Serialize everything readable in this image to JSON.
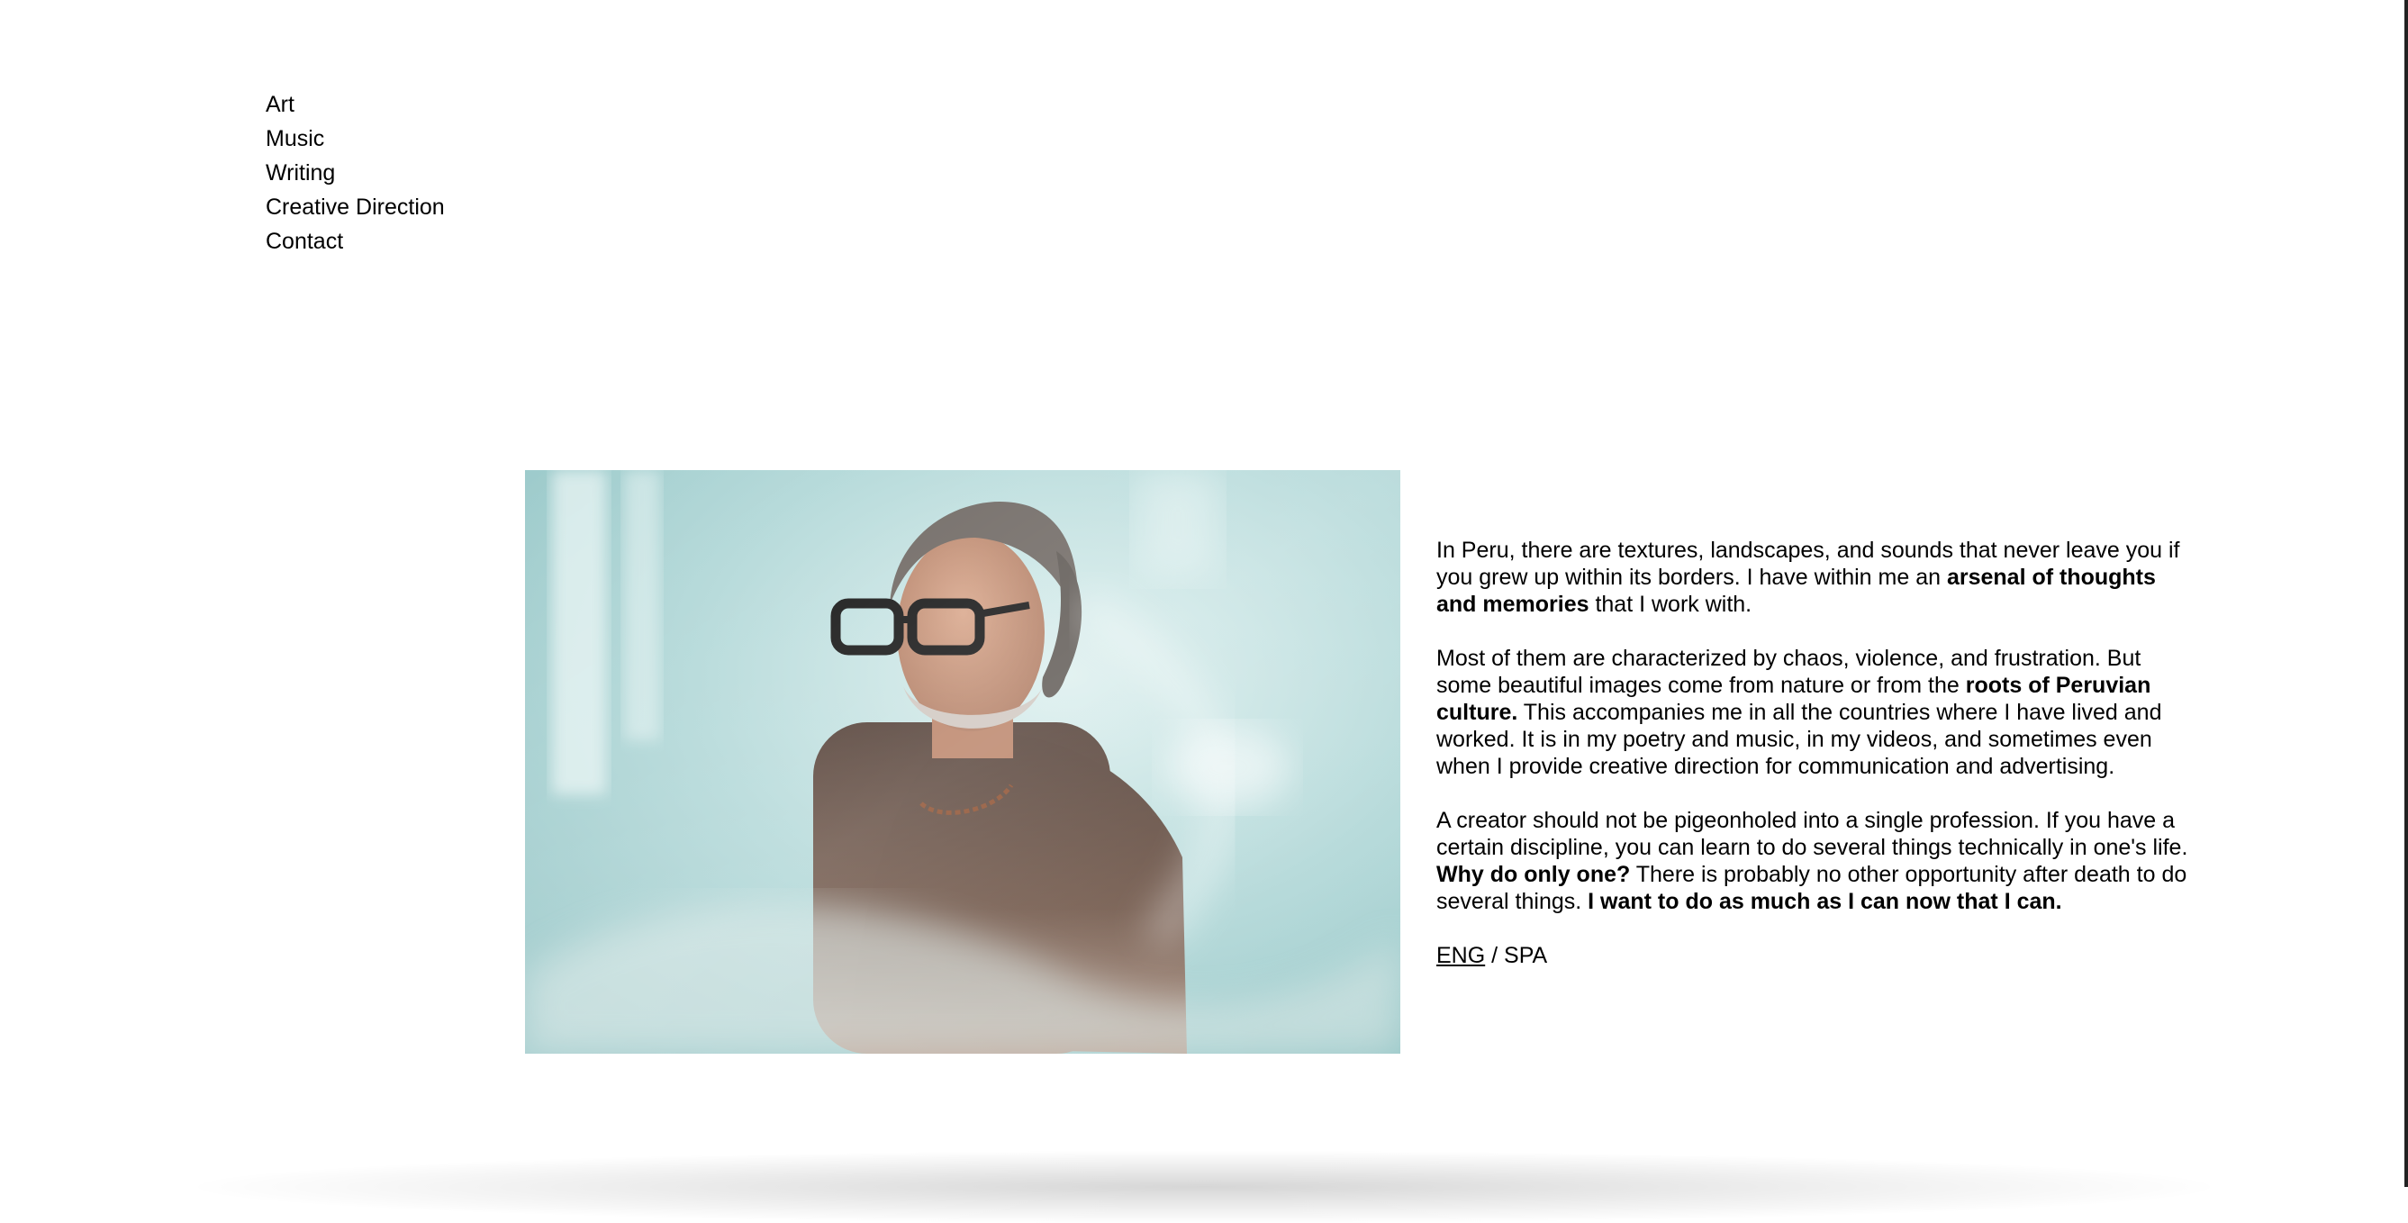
{
  "nav": {
    "items": [
      {
        "label": "Art"
      },
      {
        "label": "Music"
      },
      {
        "label": "Writing"
      },
      {
        "label": "Creative Direction"
      },
      {
        "label": "Contact"
      }
    ]
  },
  "bio": {
    "p1": {
      "t1": "In Peru, there are textures, landscapes, and sounds that never leave you if you grew up within its borders. I have within me an ",
      "b1": "arsenal of thoughts and memories",
      "t2": " that I work with."
    },
    "p2": {
      "t1": "Most of them are characterized by chaos, violence, and frustration. But some beautiful images come from nature or from the ",
      "b1": "roots of Peruvian culture.",
      "t2": " This accompanies me in all the countries where I have lived and worked. It is in my poetry and music, in my videos, and sometimes even when I provide creative direction for communication and advertising."
    },
    "p3": {
      "t1": "A creator should not be pigeonholed into a single profession. If you have a certain discipline, you can learn to do several things technically in one's life. ",
      "b1": "Why do only one?",
      "t2": " There is probably no other opportunity after death to do several things. ",
      "b2": "I want to do as much as I can now that I can."
    }
  },
  "language": {
    "eng": "ENG",
    "separator": " / ",
    "spa": "SPA",
    "active": "ENG"
  },
  "colors": {
    "background": "#ffffff",
    "text": "#000000",
    "photo_backdrop": "#a9d3d3"
  }
}
